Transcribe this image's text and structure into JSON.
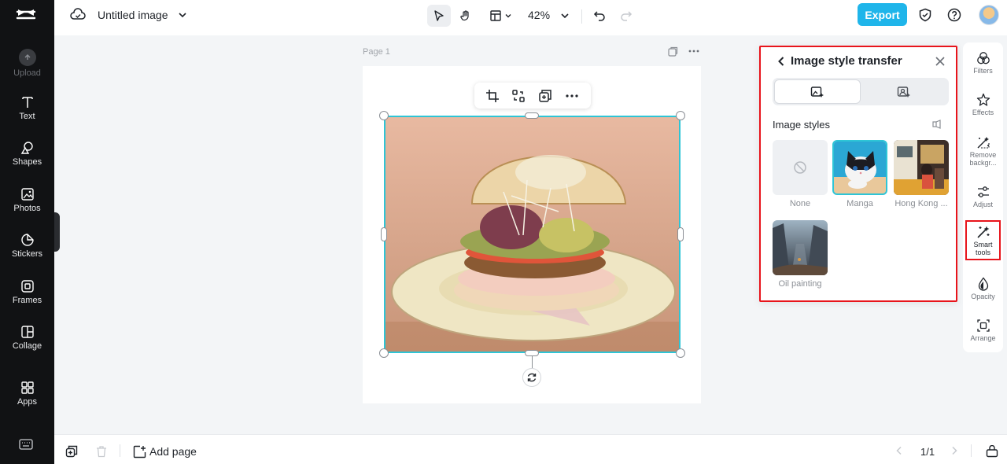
{
  "app": {
    "document_title": "Untitled image",
    "zoom": "42%",
    "export_label": "Export",
    "brand_color": "#1fb5ea",
    "selection_color": "#2ec5d6",
    "highlight_color": "#e8141b"
  },
  "sidebar": {
    "items": [
      {
        "label": "Upload",
        "icon": "upload-icon",
        "disabled": true
      },
      {
        "label": "Text",
        "icon": "text-icon"
      },
      {
        "label": "Shapes",
        "icon": "shapes-icon"
      },
      {
        "label": "Photos",
        "icon": "photos-icon"
      },
      {
        "label": "Stickers",
        "icon": "stickers-icon"
      },
      {
        "label": "Frames",
        "icon": "frames-icon"
      },
      {
        "label": "Collage",
        "icon": "collage-icon"
      },
      {
        "label": "Apps",
        "icon": "apps-icon"
      }
    ]
  },
  "canvas": {
    "page_label": "Page 1"
  },
  "style_panel": {
    "title": "Image style transfer",
    "section_title": "Image styles",
    "styles": [
      {
        "name": "None",
        "selected": false
      },
      {
        "name": "Manga",
        "selected": true
      },
      {
        "name": "Hong Kong ...",
        "selected": false
      },
      {
        "name": "Oil painting",
        "selected": false
      }
    ]
  },
  "right_rail": {
    "items": [
      {
        "label": "Filters",
        "icon": "filters-icon"
      },
      {
        "label": "Effects",
        "icon": "effects-icon"
      },
      {
        "label": "Remove backgr...",
        "icon": "remove-background-icon"
      },
      {
        "label": "Adjust",
        "icon": "adjust-icon"
      },
      {
        "label": "Smart tools",
        "icon": "smart-tools-icon",
        "highlighted": true
      },
      {
        "label": "Opacity",
        "icon": "opacity-icon"
      },
      {
        "label": "Arrange",
        "icon": "arrange-icon"
      }
    ]
  },
  "bottom_bar": {
    "add_page_label": "Add page",
    "page_count": "1/1"
  }
}
